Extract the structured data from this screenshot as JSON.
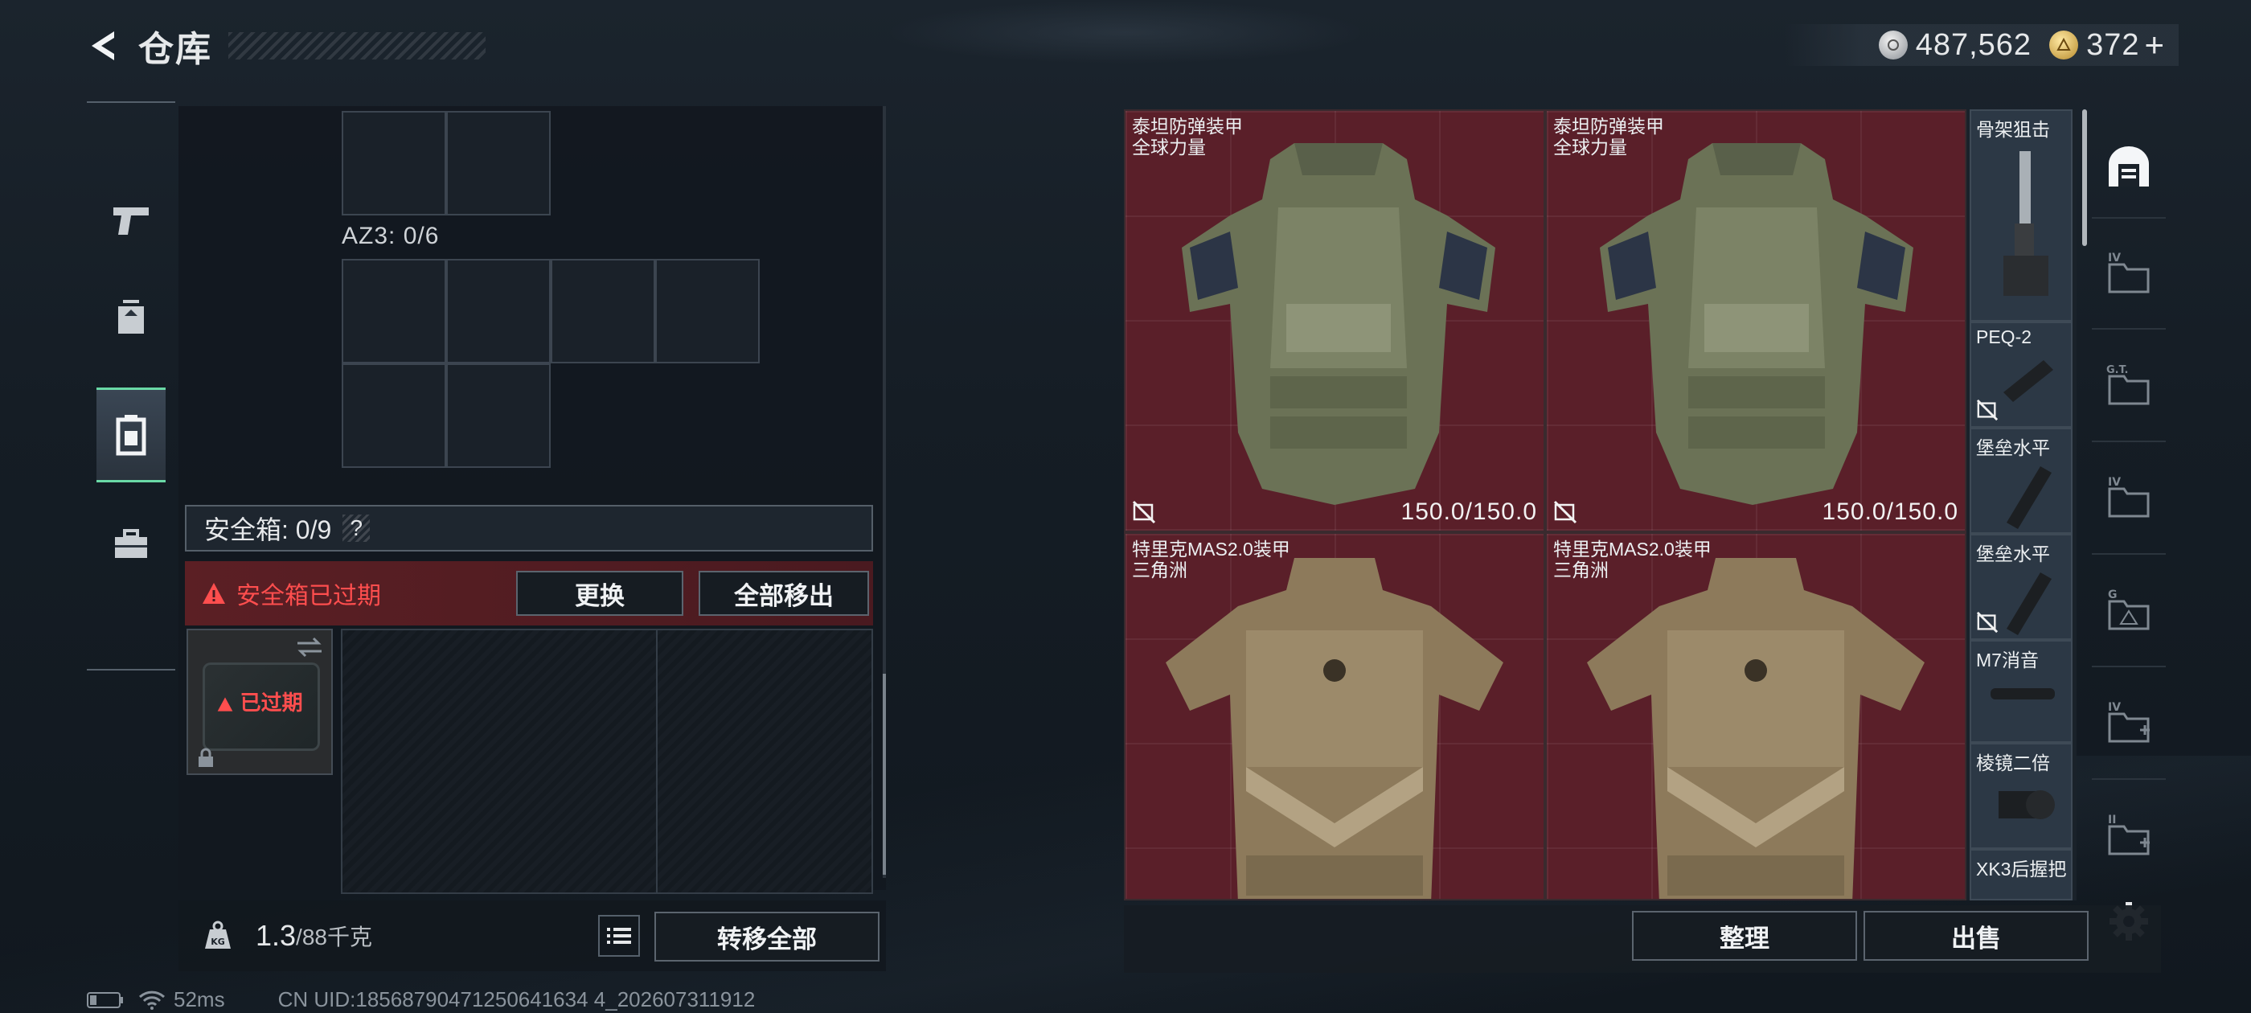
{
  "header": {
    "title": "仓库",
    "silver": "487,562",
    "gold": "372"
  },
  "left": {
    "az_label": "AZ3: 0/6",
    "safe_label": "安全箱: 0/9",
    "help": "?",
    "expired_text": "安全箱已过期",
    "replace_btn": "更换",
    "move_all_btn": "全部移出",
    "case_expired": "已过期",
    "weight_value": "1.3",
    "weight_cap": "/88千克",
    "transfer_all_btn": "转移全部"
  },
  "items": [
    {
      "name": "泰坦防弹装甲",
      "sub": "全球力量",
      "durability": "150.0/150.0"
    },
    {
      "name": "泰坦防弹装甲",
      "sub": "全球力量",
      "durability": "150.0/150.0"
    },
    {
      "name": "特里克MAS2.0装甲",
      "sub": "三角洲",
      "durability": ""
    },
    {
      "name": "特里克MAS2.0装甲",
      "sub": "三角洲",
      "durability": ""
    }
  ],
  "side_items": [
    {
      "name": "骨架狙击"
    },
    {
      "name": "PEQ-2"
    },
    {
      "name": "堡垒水平"
    },
    {
      "name": "堡垒水平"
    },
    {
      "name": "M7消音"
    },
    {
      "name": "棱镜二倍"
    },
    {
      "name": "XK3后握把"
    }
  ],
  "bottom": {
    "sort_btn": "整理",
    "sell_btn": "出售"
  },
  "status": {
    "ping": "52ms",
    "uid": "CN UID:18568790471250641634 4_202607311912"
  }
}
